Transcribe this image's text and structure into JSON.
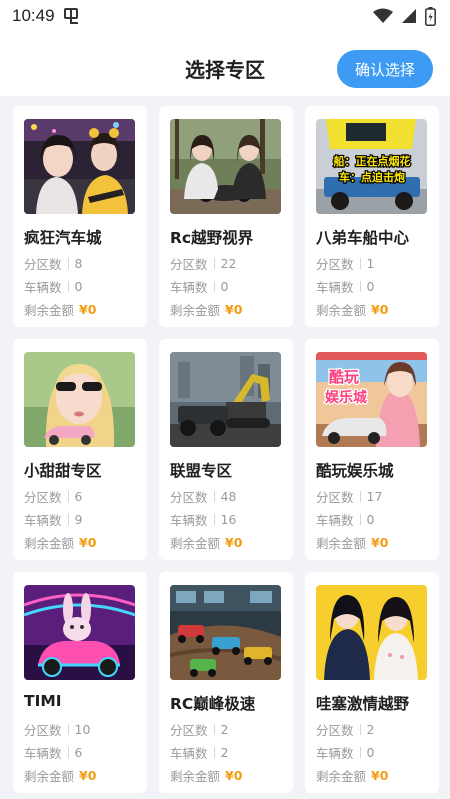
{
  "status_bar": {
    "time": "10:49"
  },
  "header": {
    "title": "选择专区",
    "confirm_button": "确认选择"
  },
  "labels": {
    "zones": "分区数",
    "vehicles": "车辆数",
    "balance": "剩余金额"
  },
  "zones": [
    {
      "name": "疯狂汽车城",
      "zones": "8",
      "vehicles": "0",
      "balance": "¥0"
    },
    {
      "name": "Rc越野视界",
      "zones": "22",
      "vehicles": "0",
      "balance": "¥0"
    },
    {
      "name": "八弟车船中心",
      "zones": "1",
      "vehicles": "0",
      "balance": "¥0",
      "image_text": [
        "船：正在点烟花",
        "车：点迫击炮"
      ]
    },
    {
      "name": "小甜甜专区",
      "zones": "6",
      "vehicles": "9",
      "balance": "¥0"
    },
    {
      "name": "联盟专区",
      "zones": "48",
      "vehicles": "16",
      "balance": "¥0"
    },
    {
      "name": "酷玩娱乐城",
      "zones": "17",
      "vehicles": "0",
      "balance": "¥0",
      "image_text": [
        "酷玩",
        "娱乐城"
      ]
    },
    {
      "name": "TIMI",
      "zones": "10",
      "vehicles": "6",
      "balance": "¥0"
    },
    {
      "name": "RC巅峰极速",
      "zones": "2",
      "vehicles": "2",
      "balance": "¥0"
    },
    {
      "name": "哇塞激情越野",
      "zones": "2",
      "vehicles": "0",
      "balance": "¥0"
    }
  ],
  "colors": {
    "accent": "#3d9bf3",
    "money": "#f39c12",
    "background": "#f1f3f6"
  }
}
